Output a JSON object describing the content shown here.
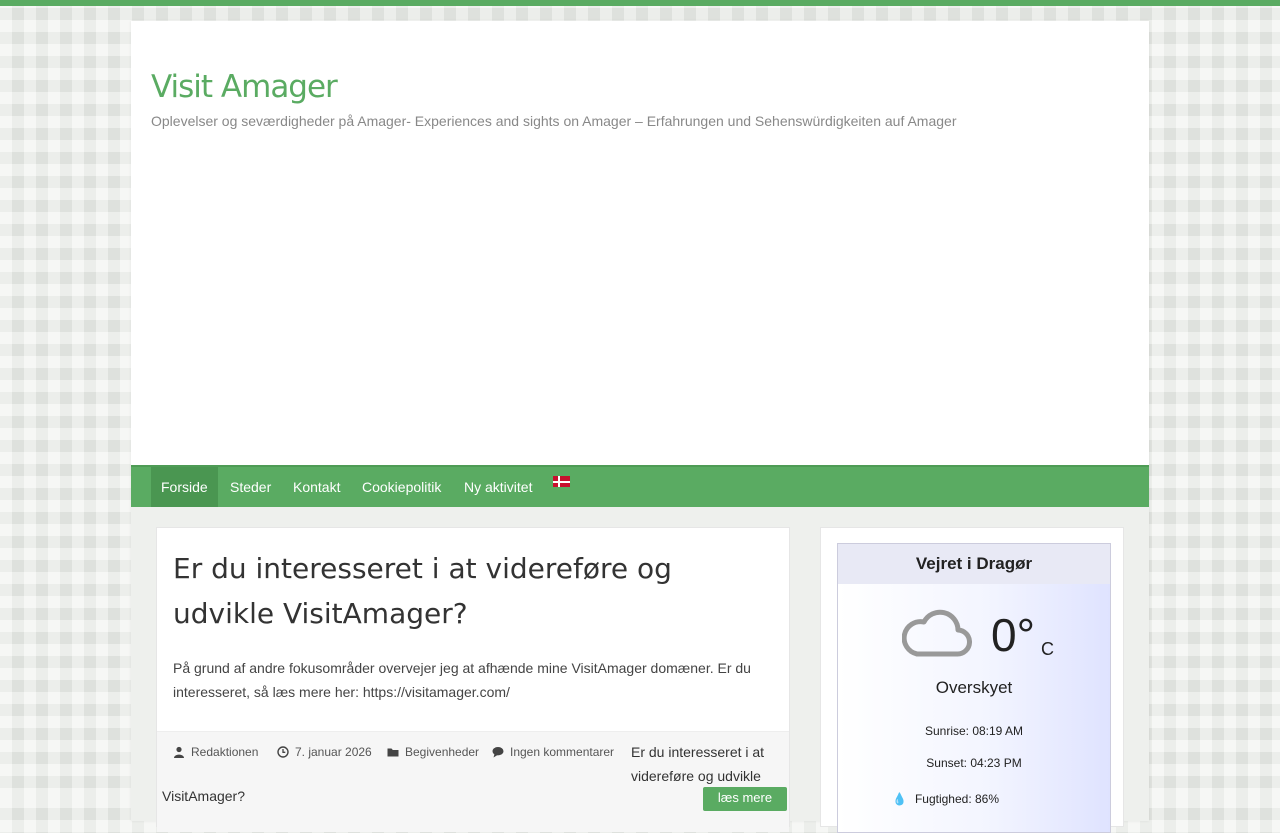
{
  "site": {
    "title": "Visit Amager",
    "description": "Oplevelser og seværdigheder på Amager- Experiences and sights on Amager – Erfahrungen und Sehenswürdigkeiten auf Amager"
  },
  "nav": {
    "items": [
      {
        "label": "Forside"
      },
      {
        "label": "Steder"
      },
      {
        "label": "Kontakt"
      },
      {
        "label": "Cookiepolitik"
      },
      {
        "label": "Ny aktivitet"
      }
    ],
    "language_flag": "danish-flag-icon"
  },
  "post": {
    "title": "Er du interesseret i at videreføre og udvikle VisitAmager?",
    "excerpt": "På grund af andre fokusområder overvejer jeg at afhænde mine VisitAmager domæner. Er du interesseret, så læs mere her: https://visitamager.com/",
    "author": "Redaktionen",
    "date": "7. januar 2026",
    "category": "Begivenheder",
    "comments": "Ingen kommentarer",
    "readmore_text_a": "Er du interesseret i at videreføre og udvikle",
    "readmore_text_b": "VisitAmager?",
    "readmore_button": "læs mere"
  },
  "weather": {
    "heading": "Vejret i Dragør",
    "temperature": "0°",
    "unit": "C",
    "condition": "Overskyet",
    "sunrise": "Sunrise: 08:19 AM",
    "sunset": "Sunset: 04:23 PM",
    "humidity": "Fugtighed: 86%",
    "icon": "cloud-icon"
  },
  "colors": {
    "accent": "#5aab62",
    "accent_dark": "#4a9651"
  }
}
